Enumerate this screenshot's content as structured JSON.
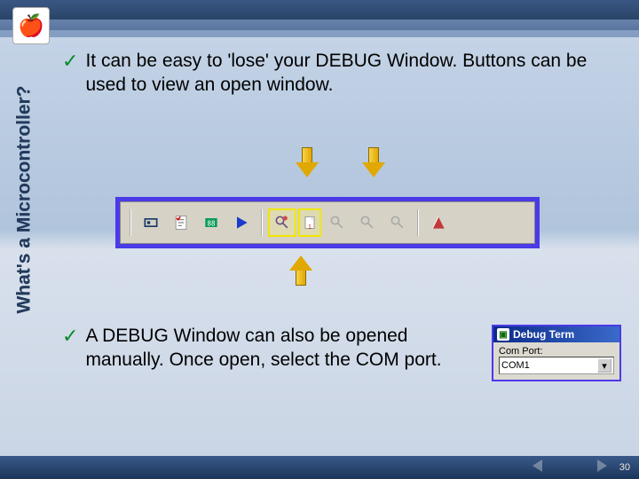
{
  "side_title": "What's a Microcontroller?",
  "bullet1": "It can be easy to 'lose' your DEBUG Window.  Buttons can be used to view an open window.",
  "bullet2": "A DEBUG Window can also be opened manually.  Once open, select the COM port.",
  "toolbar": {
    "icons": [
      "id-chip-icon",
      "checklist-icon",
      "chip-88-icon",
      "play-icon",
      "debug1-icon",
      "debug-new-icon",
      "debug2-icon",
      "debug3-icon",
      "debug4-icon",
      "help-icon"
    ]
  },
  "debug_terminal": {
    "title": "Debug Term",
    "comport_label": "Com Port:",
    "comport_value": "COM1"
  },
  "page_number": "30"
}
